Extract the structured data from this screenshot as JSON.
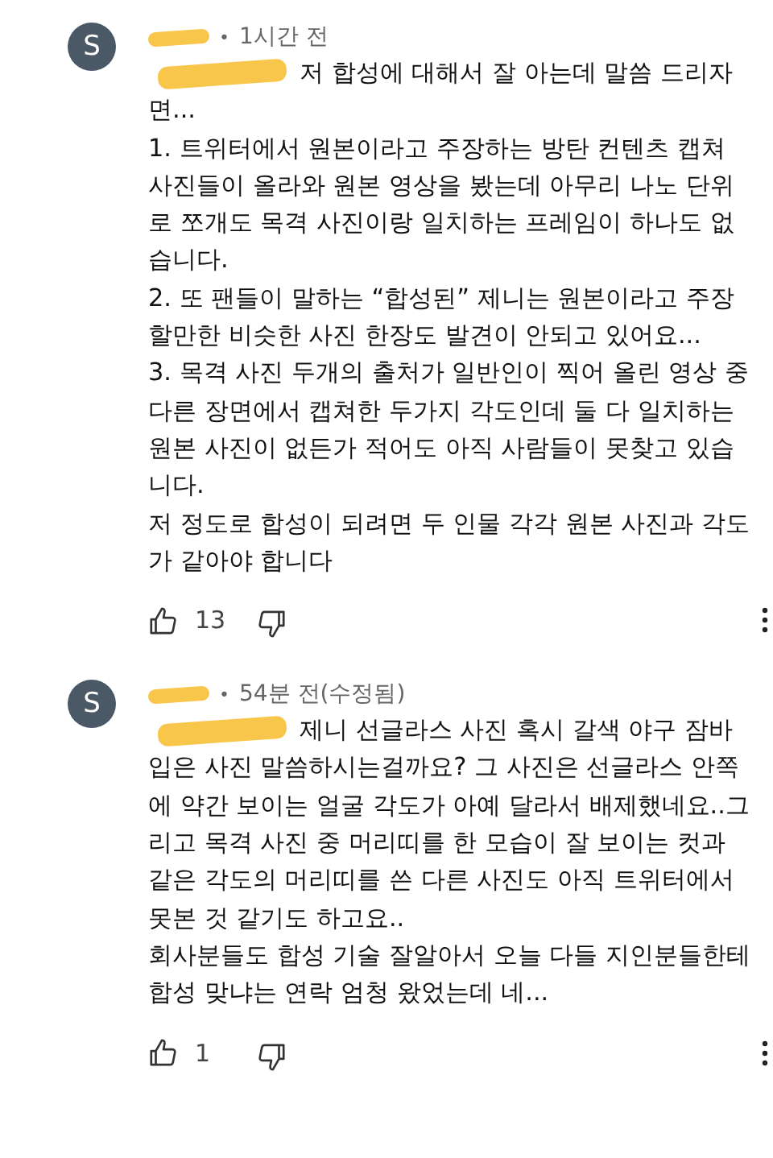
{
  "comments": [
    {
      "avatar": "S",
      "author_redacted": true,
      "separator": "•",
      "time": "1시간 전",
      "mention_redacted": true,
      "paragraphs": [
        "저 합성에 대해서 잘 아는데 말씀 드리자면...",
        "1. 트위터에서 원본이라고 주장하는 방탄 컨텐츠 캡쳐 사진들이 올라와 원본 영상을 봤는데 아무리 나노 단위로 쪼개도 목격 사진이랑 일치하는 프레임이 하나도 없습니다.",
        "2. 또 팬들이 말하는 “합성된” 제니는 원본이라고 주장할만한 비슷한 사진 한장도 발견이 안되고 있어요...",
        "3. 목격 사진 두개의 출처가 일반인이 찍어 올린 영상 중 다른 장면에서 캡쳐한 두가지 각도인데 둘 다 일치하는 원본 사진이 없든가 적어도 아직 사람들이 못찾고 있습니다.",
        "저 정도로 합성이 되려면 두 인물 각각 원본 사진과 각도가 같아야 합니다"
      ],
      "likes": "13"
    },
    {
      "avatar": "S",
      "author_redacted": true,
      "separator": "•",
      "time": "54분 전(수정됨)",
      "mention_redacted": true,
      "paragraphs": [
        "제니 선글라스 사진 혹시 갈색 야구 잠바 입은 사진 말씀하시는걸까요? 그 사진은 선글라스 안쪽에 약간 보이는 얼굴 각도가 아예 달라서 배제했네요..그리고 목격 사진 중 머리띠를 한 모습이 잘 보이는 컷과 같은 각도의 머리띠를 쓴 다른 사진도 아직 트위터에서 못본 것 같기도 하고요..",
        "회사분들도 합성 기술 잘알아서 오늘 다들 지인분들한테 합성 맞냐는 연락 엄청 왔었는데 네..."
      ],
      "likes": "1"
    }
  ]
}
